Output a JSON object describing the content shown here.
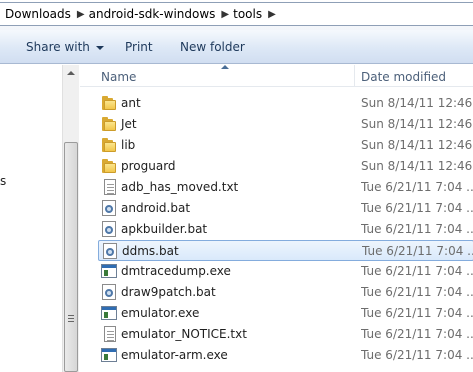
{
  "address": {
    "crumbs": [
      "Downloads",
      "android-sdk-windows",
      "tools"
    ],
    "separator": "▶"
  },
  "toolbar": {
    "share_label": "Share with",
    "print_label": "Print",
    "new_folder_label": "New folder"
  },
  "nav": {
    "fragment": "s"
  },
  "columns": {
    "name": "Name",
    "date_modified": "Date modified"
  },
  "files": [
    {
      "name": "ant",
      "date": "Sun 8/14/11 12:46 ...",
      "type": "folder",
      "icon": "folder-icon"
    },
    {
      "name": "Jet",
      "date": "Sun 8/14/11 12:46 ...",
      "type": "folder",
      "icon": "folder-icon"
    },
    {
      "name": "lib",
      "date": "Sun 8/14/11 12:46 ...",
      "type": "folder",
      "icon": "folder-icon"
    },
    {
      "name": "proguard",
      "date": "Sun 8/14/11 12:46 ...",
      "type": "folder",
      "icon": "folder-icon"
    },
    {
      "name": "adb_has_moved.txt",
      "date": "Tue 6/21/11 7:04 ...",
      "type": "txt",
      "icon": "text-file-icon"
    },
    {
      "name": "android.bat",
      "date": "Tue 6/21/11 7:04 ...",
      "type": "bat",
      "icon": "batch-file-icon"
    },
    {
      "name": "apkbuilder.bat",
      "date": "Tue 6/21/11 7:04 ...",
      "type": "bat",
      "icon": "batch-file-icon"
    },
    {
      "name": "ddms.bat",
      "date": "Tue 6/21/11 7:04 ...",
      "type": "bat",
      "icon": "batch-file-icon",
      "selected": true
    },
    {
      "name": "dmtracedump.exe",
      "date": "Tue 6/21/11 7:04 ...",
      "type": "exe",
      "icon": "executable-icon"
    },
    {
      "name": "draw9patch.bat",
      "date": "Tue 6/21/11 7:04 ...",
      "type": "bat",
      "icon": "batch-file-icon"
    },
    {
      "name": "emulator.exe",
      "date": "Tue 6/21/11 7:04 ...",
      "type": "exe",
      "icon": "executable-icon"
    },
    {
      "name": "emulator_NOTICE.txt",
      "date": "Tue 6/21/11 7:04 ...",
      "type": "txt",
      "icon": "text-file-icon"
    },
    {
      "name": "emulator-arm.exe",
      "date": "Tue 6/21/11 7:04 ...",
      "type": "exe",
      "icon": "executable-icon"
    }
  ]
}
